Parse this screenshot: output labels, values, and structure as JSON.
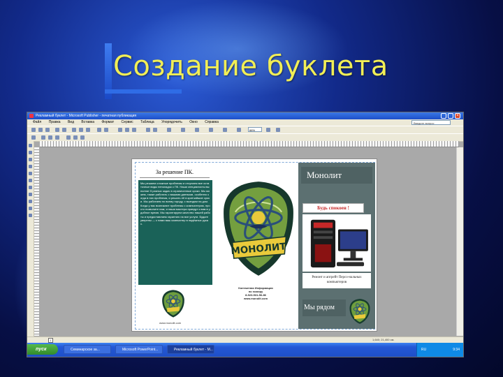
{
  "slide": {
    "title": "Создание буклета"
  },
  "window": {
    "title": "Рекламный буклет - Microsoft Publisher - печатная публикация",
    "menu": [
      "Файл",
      "Правка",
      "Вид",
      "Вставка",
      "Формат",
      "Сервис",
      "Таблица",
      "Упорядочить",
      "Окно",
      "Справка"
    ],
    "help_placeholder": "Введите вопрос",
    "zoom": "66%",
    "status_coords": "1,640; 21,400 см."
  },
  "taskbar": {
    "start_label": "пуск",
    "tasks": [
      "Семинарское за...",
      "Microsoft PowerPoint...",
      "Рекламный буклет - M..."
    ],
    "lang": "RU",
    "clock": "9:34"
  },
  "brochure": {
    "col1_heading": "За решение ПК.",
    "col1_body": "Мы решаем сложные проблемы и отсупаем все остаточные виды неполадок с ПК. Наши специалисты выполнят 5 разных задач в ограниченные сроки. Мы можем, также работать с вашими данными, особенно когда в них проблема, и решить её в кратчайшие сроки. Мы работаем по всему городу, с выездом на дом. Когда у вас возникают проблемы с компьютером, просто позвоните нам, и наши мастера приедут к вам в удобное время. Мы гарантируем качество нашей работы и предоставляем гарантию на все услуги. Будьте уверены — с нами ваш компьютер в надёжных руках.",
    "col1_url": "www.monolit.com",
    "contacts": [
      "Контактная Информация",
      "по номеру",
      "8-923-531-56-86",
      "www.monolit.com"
    ],
    "shield_text": "МОНОЛИТ",
    "monolit": "Монолит",
    "calm": "Будь спокоен !",
    "repair": "Ремонт и апгрейт Персо-нальных компьютеров",
    "near": "Мы рядом",
    "colors": {
      "accent_teal": "#1a6258",
      "panel": "#5c7071",
      "calm_text": "#c62828",
      "title": "#f1ee56"
    }
  }
}
